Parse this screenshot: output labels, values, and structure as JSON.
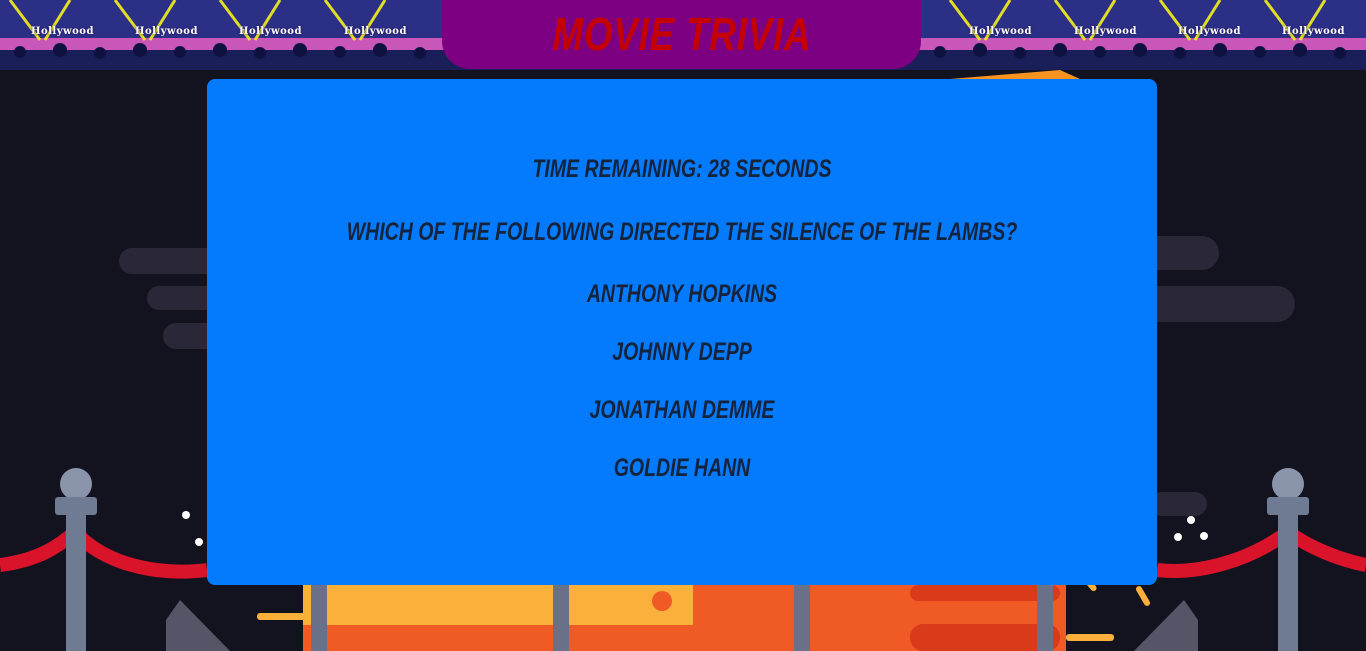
{
  "header": {
    "title": "Movie Trivia",
    "sign_labels": [
      "Hollywood",
      "Hollywood",
      "Hollywood",
      "Hollywood",
      "Hollywood",
      "Hollywood",
      "Hollywood",
      "Hollywood"
    ]
  },
  "game": {
    "timer_text": "Time Remaining: 28 Seconds",
    "question": "Which of the following directed The Silence of the Lambs?",
    "answers": [
      "Anthony Hopkins",
      "Johnny Depp",
      "Jonathan Demme",
      "Goldie Hann"
    ]
  },
  "colors": {
    "panel": "#037bfc",
    "banner": "#7d0083",
    "title": "#c40000",
    "text": "#15233c",
    "background": "#13121f"
  }
}
